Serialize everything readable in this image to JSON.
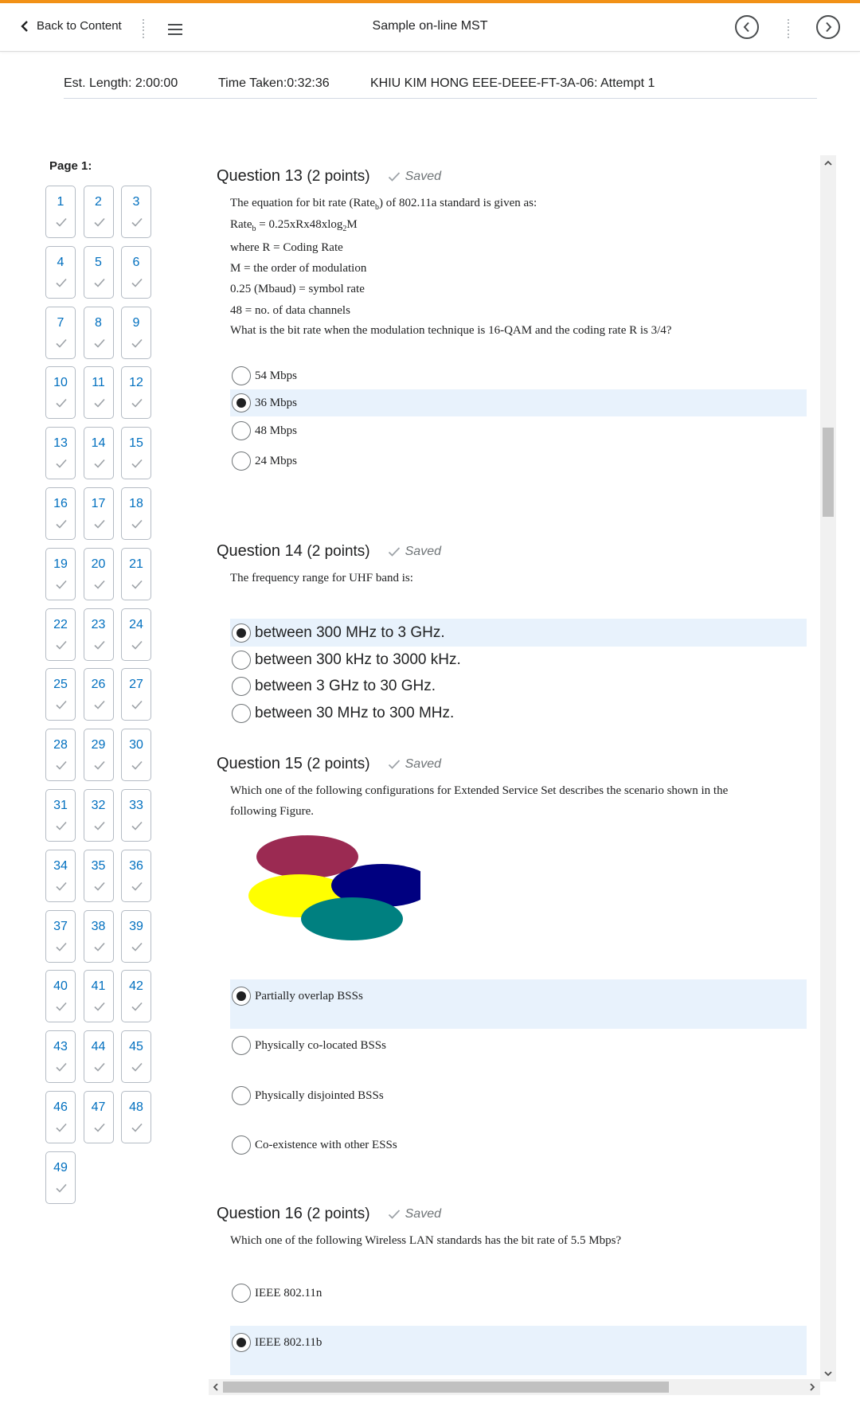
{
  "topbar": {
    "back_label": "Back to Content",
    "title": "Sample on-line MST"
  },
  "info": {
    "est_length": "Est. Length: 2:00:00",
    "time_taken": "Time Taken:0:32:36",
    "attempt": "KHIU KIM HONG EEE-DEEE-FT-3A-06: Attempt 1"
  },
  "nav": {
    "page_label": "Page 1:",
    "questions": [
      "1",
      "2",
      "3",
      "4",
      "5",
      "6",
      "7",
      "8",
      "9",
      "10",
      "11",
      "12",
      "13",
      "14",
      "15",
      "16",
      "17",
      "18",
      "19",
      "20",
      "21",
      "22",
      "23",
      "24",
      "25",
      "26",
      "27",
      "28",
      "29",
      "30",
      "31",
      "32",
      "33",
      "34",
      "35",
      "36",
      "37",
      "38",
      "39",
      "40",
      "41",
      "42",
      "43",
      "44",
      "45",
      "46",
      "47",
      "48",
      "49"
    ]
  },
  "questions": [
    {
      "label": "Question 13",
      "points": "(2 points)",
      "status": "Saved",
      "lines": [
        {
          "pre": "The equation for bit rate (Rate",
          "sub": "b",
          "post": ") of 802.11a standard is given as:"
        },
        {
          "pre": "Rate",
          "sub": "b",
          "post": " = 0.25xRx48xlog",
          "sub2": "2",
          "post2": "M"
        },
        {
          "pre": "where R = Coding Rate"
        },
        {
          "pre": "M = the order of modulation"
        },
        {
          "pre": "0.25 (Mbaud) = symbol rate"
        },
        {
          "pre": "48 = no. of data channels"
        },
        {
          "pre": "What is the bit rate when the modulation technique is 16-QAM and the coding rate R is 3/4?"
        }
      ],
      "options": [
        "54 Mbps",
        "36 Mbps",
        "48 Mbps",
        "24 Mbps"
      ],
      "selected": 1
    },
    {
      "label": "Question 14",
      "points": "(2 points)",
      "status": "Saved",
      "lines": [
        {
          "pre": "The frequency range for UHF band is:"
        }
      ],
      "options": [
        "between 300 MHz to 3 GHz.",
        "between 300 kHz to 3000 kHz.",
        "between 3 GHz to 30 GHz.",
        "between 30 MHz to 300 MHz."
      ],
      "selected": 0
    },
    {
      "label": "Question 15",
      "points": "(2 points)",
      "status": "Saved",
      "lines": [
        {
          "pre": "Which one of the following configurations for Extended Service Set describes the scenario shown in the"
        },
        {
          "pre": "following Figure."
        }
      ],
      "figure_colors": [
        "#9b2a52",
        "#ffff00",
        "#000080",
        "#008080"
      ],
      "options": [
        "Partially overlap BSSs",
        "Physically co-located BSSs",
        "Physically disjointed BSSs",
        "Co-existence with other ESSs"
      ],
      "selected": 0
    },
    {
      "label": "Question 16",
      "points": "(2 points)",
      "status": "Saved",
      "lines": [
        {
          "pre": "Which one of the following Wireless LAN standards has the bit rate of 5.5 Mbps?"
        }
      ],
      "options": [
        "IEEE 802.11n",
        "IEEE 802.11b"
      ],
      "selected": 1
    }
  ]
}
